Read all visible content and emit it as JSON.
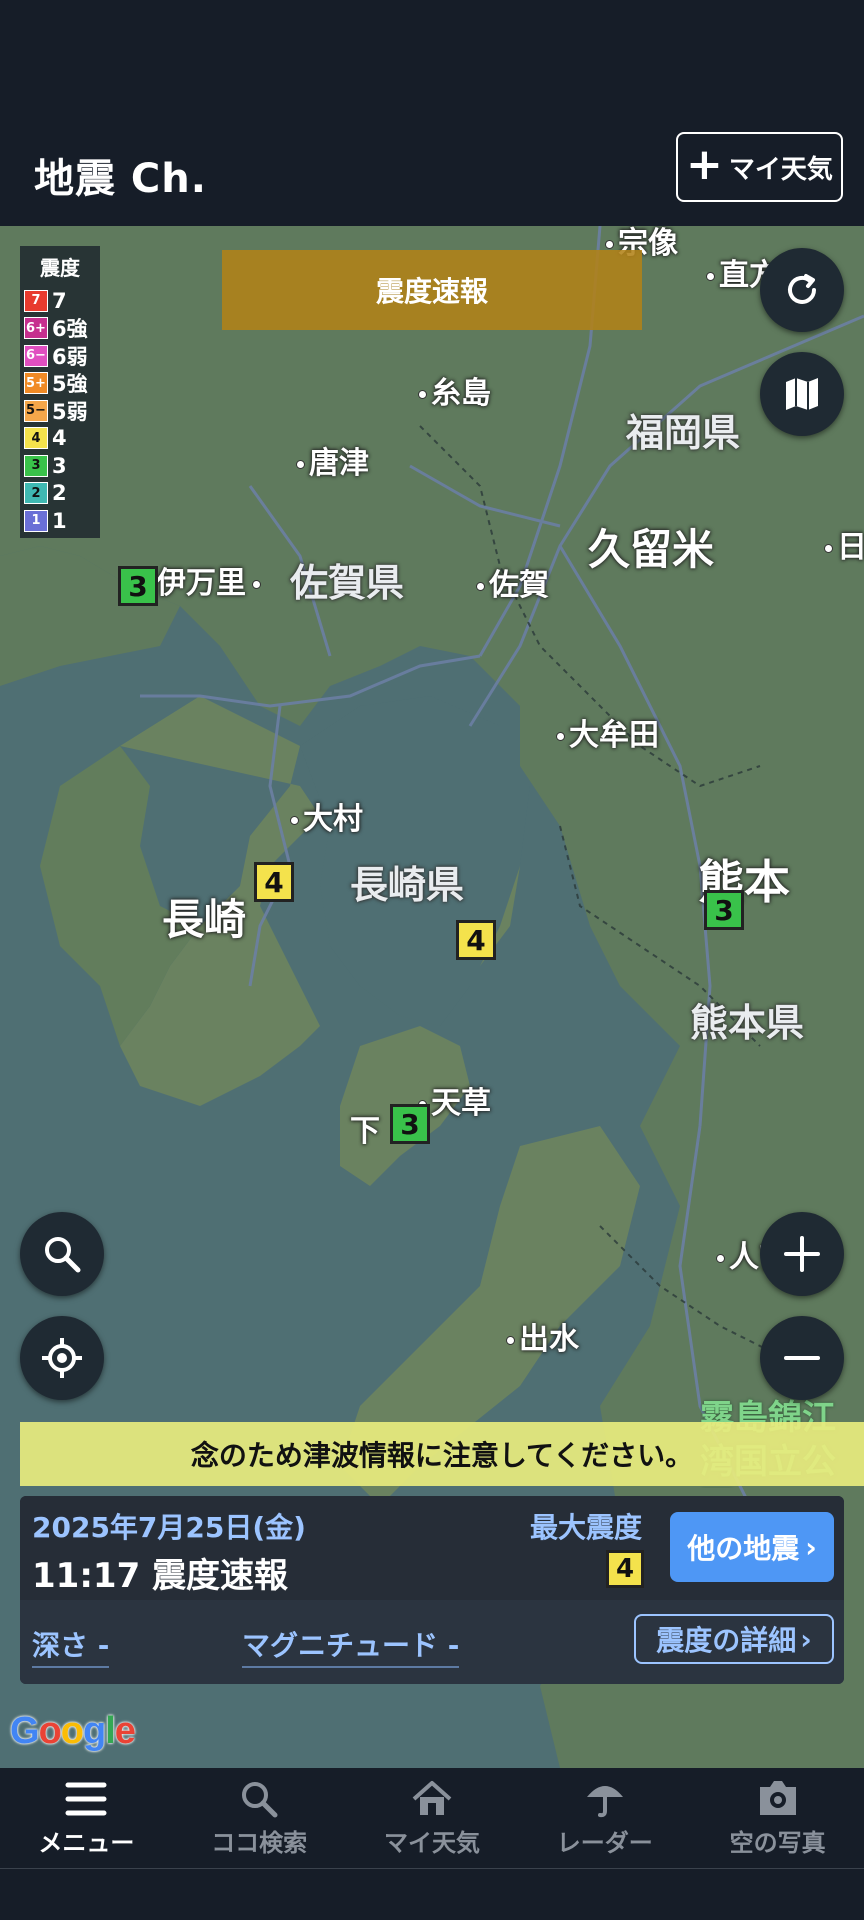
{
  "header": {
    "title": "地震 Ch.",
    "my_weather_label": "マイ天気"
  },
  "legend": {
    "title": "震度",
    "items": [
      {
        "code": "7",
        "label": "7",
        "color": "#e83b2e"
      },
      {
        "code": "6+",
        "label": "6強",
        "color": "#c62f8e"
      },
      {
        "code": "6−",
        "label": "6弱",
        "color": "#e04fc0"
      },
      {
        "code": "5+",
        "label": "5強",
        "color": "#f08a25"
      },
      {
        "code": "5−",
        "label": "5弱",
        "color": "#f4a64a"
      },
      {
        "code": "4",
        "label": "4",
        "color": "#f4e24c"
      },
      {
        "code": "3",
        "label": "3",
        "color": "#39c24a"
      },
      {
        "code": "2",
        "label": "2",
        "color": "#3fb8b2"
      },
      {
        "code": "1",
        "label": "1",
        "color": "#6a6fd6"
      }
    ]
  },
  "banner": {
    "text": "震度速報"
  },
  "map": {
    "places": {
      "munakata": "宗像",
      "nogata": "直方",
      "itoshima": "糸島",
      "fukuoka_pref": "福岡県",
      "karatsu": "唐津",
      "kurume": "久留米",
      "hita": "日",
      "imari": "伊万里",
      "saga_pref": "佐賀県",
      "saga": "佐賀",
      "omuta": "大牟田",
      "omura": "大村",
      "kumamoto": "熊本",
      "nagasaki_pref": "長崎県",
      "nagasaki": "長崎",
      "kumamoto_pref": "熊本県",
      "amakusa": "天草",
      "shimoda": "下",
      "hitoyoshi": "人吉",
      "izumi": "出水",
      "park": "霧島錦江湾国立公園"
    },
    "markers": [
      {
        "id": "imari",
        "intensity": "3"
      },
      {
        "id": "nagasaki",
        "intensity": "4"
      },
      {
        "id": "shimabara",
        "intensity": "4"
      },
      {
        "id": "kumamoto",
        "intensity": "3"
      },
      {
        "id": "amakusa",
        "intensity": "3"
      }
    ],
    "attribution": "Google"
  },
  "tsunami": {
    "text": "念のため津波情報に注意してください。"
  },
  "quake": {
    "date": "2025年7月25日(金)",
    "time_title": "11:17 震度速報",
    "max_label": "最大震度",
    "max_intensity": "4",
    "other_button": "他の地震",
    "depth": "深さ -",
    "magnitude": "マグニチュード -",
    "detail_button": "震度の詳細"
  },
  "nav": {
    "menu": "メニュー",
    "search": "ココ検索",
    "my_weather": "マイ天気",
    "radar": "レーダー",
    "sky_photo": "空の写真"
  },
  "colors": {
    "header_bg": "#161d28",
    "accent_blue": "#4e97f5",
    "intensity_3": "#39c24a",
    "intensity_4": "#f4e24c",
    "tsunami_bg": "#e8ec7e"
  }
}
